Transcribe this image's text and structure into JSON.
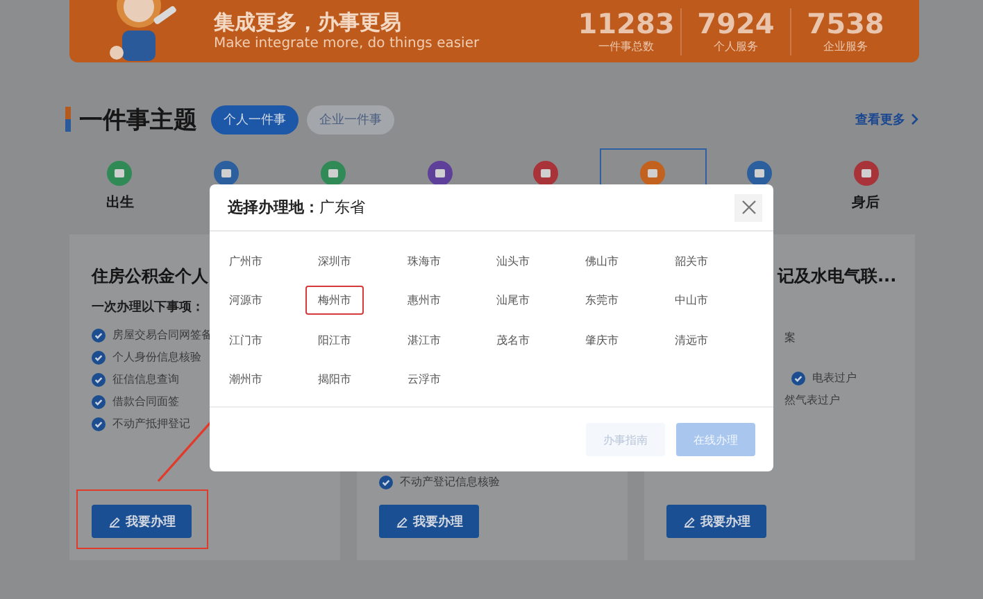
{
  "banner": {
    "heading": "集成更多，办事更易",
    "subheading": "Make integrate more, do things easier",
    "stats": [
      {
        "value": "11283",
        "label": "一件事总数"
      },
      {
        "value": "7924",
        "label": "个人服务"
      },
      {
        "value": "7538",
        "label": "企业服务"
      }
    ]
  },
  "section": {
    "title": "一件事主题",
    "tabs": [
      {
        "label": "个人一件事",
        "selected": true
      },
      {
        "label": "企业一件事",
        "selected": false
      }
    ],
    "more_link": "查看更多"
  },
  "topics": [
    {
      "label": "出生",
      "color": "#2f8a55",
      "selected": false
    },
    {
      "color": "#2c5f9e",
      "selected": false
    },
    {
      "color": "#2f8a55",
      "selected": false
    },
    {
      "color": "#5e3f9a",
      "selected": false
    },
    {
      "color": "#a8343a",
      "selected": false
    },
    {
      "color": "#c2621e",
      "selected": true
    },
    {
      "color": "#2c5f9e",
      "selected": false
    },
    {
      "label": "身后",
      "color": "#a8343a",
      "selected": false
    }
  ],
  "cards": [
    {
      "title": "住房公积金个人",
      "subtitle": "一次办理以下事项：",
      "items": [
        {
          "text": "房屋交易合同网签备"
        },
        {
          "text": "个人身份信息核验"
        },
        {
          "text": "征信信息查询"
        },
        {
          "text": "借款合同面签"
        },
        {
          "text": "不动产抵押登记"
        }
      ],
      "button": "我要办理"
    },
    {
      "items": [
        {
          "text": "不动产登记信息核验"
        }
      ],
      "button": "我要办理"
    },
    {
      "title": "记及水电气联...",
      "items": [
        {
          "text": "案",
          "kind": "plain"
        },
        {
          "text": "电表过户",
          "kind": "check"
        },
        {
          "text": "然气表过户",
          "kind": "plain"
        }
      ],
      "button": "我要办理"
    }
  ],
  "dialog": {
    "title": "选择办理地：",
    "province": "广东省",
    "cities": [
      {
        "name": "广州市",
        "selected": false
      },
      {
        "name": "深圳市",
        "selected": false
      },
      {
        "name": "珠海市",
        "selected": false
      },
      {
        "name": "汕头市",
        "selected": false
      },
      {
        "name": "佛山市",
        "selected": false
      },
      {
        "name": "韶关市",
        "selected": false
      },
      {
        "name": "河源市",
        "selected": false
      },
      {
        "name": "梅州市",
        "selected": true
      },
      {
        "name": "惠州市",
        "selected": false
      },
      {
        "name": "汕尾市",
        "selected": false
      },
      {
        "name": "东莞市",
        "selected": false
      },
      {
        "name": "中山市",
        "selected": false
      },
      {
        "name": "江门市",
        "selected": false
      },
      {
        "name": "阳江市",
        "selected": false
      },
      {
        "name": "湛江市",
        "selected": false
      },
      {
        "name": "茂名市",
        "selected": false
      },
      {
        "name": "肇庆市",
        "selected": false
      },
      {
        "name": "清远市",
        "selected": false
      },
      {
        "name": "潮州市",
        "selected": false
      },
      {
        "name": "揭阳市",
        "selected": false
      },
      {
        "name": "云浮市",
        "selected": false
      }
    ],
    "buttons": [
      {
        "label": "办事指南",
        "kind": "secondary"
      },
      {
        "label": "在线办理",
        "kind": "primary"
      }
    ]
  }
}
